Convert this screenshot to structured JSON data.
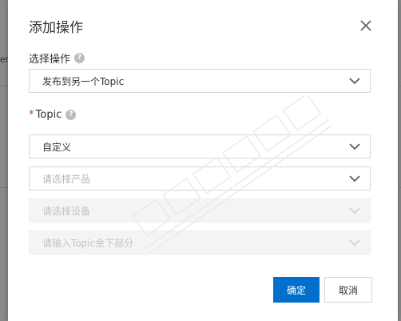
{
  "background": {
    "left_text": "er"
  },
  "dialog": {
    "title": "添加操作",
    "action_field": {
      "label": "选择操作",
      "value": "发布到另一个Topic"
    },
    "topic_field": {
      "required_mark": "*",
      "label": "Topic",
      "type_value": "自定义",
      "product_placeholder": "请选择产品",
      "device_placeholder": "请选择设备",
      "topic_rest_placeholder": "请输入Topic余下部分"
    },
    "buttons": {
      "ok": "确定",
      "cancel": "取消"
    }
  },
  "colors": {
    "primary": "#0070cc",
    "required": "#e4393c",
    "overlay": "#8a8a8a"
  }
}
